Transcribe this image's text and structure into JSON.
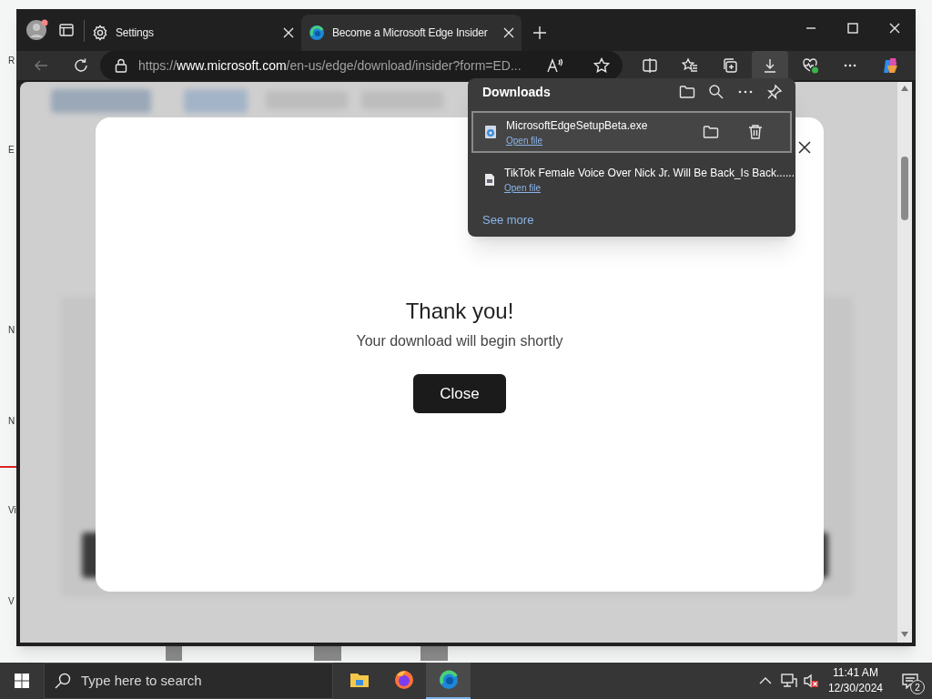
{
  "desktop_labels": [
    "R",
    "E",
    "N",
    "N",
    "Vi",
    "V"
  ],
  "tabs": [
    {
      "label": "Settings",
      "selected": false,
      "kind": "settings"
    },
    {
      "label": "Become a Microsoft Edge Insider",
      "selected": true,
      "kind": "edge"
    }
  ],
  "address": {
    "scheme": "https://",
    "host": "www.microsoft.com",
    "path": "/en-us/edge/download/insider?form=ED..."
  },
  "downloads": {
    "title": "Downloads",
    "items": [
      {
        "name": "MicrosoftEdgeSetupBeta.exe",
        "action": "Open file",
        "selected": true,
        "kind": "installer"
      },
      {
        "name": "TikTok Female Voice Over Nick Jr. Will Be Back_Is Back......",
        "action": "Open file",
        "selected": false,
        "kind": "document"
      }
    ],
    "see_more": "See more"
  },
  "dialog": {
    "title": "Thank you!",
    "message": "Your download will begin shortly",
    "button": "Close"
  },
  "taskbar": {
    "search_placeholder": "Type here to search",
    "apps": [
      {
        "kind": "folder",
        "selected": false
      },
      {
        "kind": "firefox",
        "selected": false
      },
      {
        "kind": "edge",
        "selected": true
      }
    ],
    "time": "11:41 AM",
    "date": "12/30/2024",
    "notifications": "2"
  }
}
